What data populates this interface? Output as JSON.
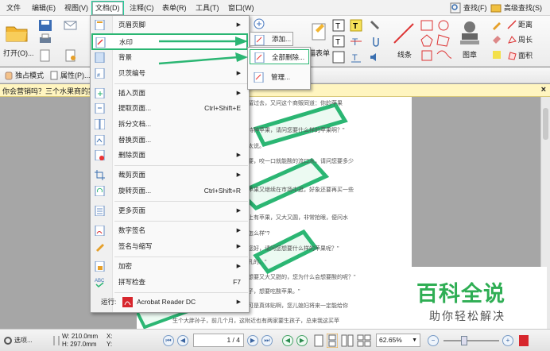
{
  "menubar": {
    "items": [
      "文件",
      "编辑(E)",
      "视图(V)",
      "文档(D)",
      "注释(C)",
      "表单(R)",
      "工具(T)",
      "窗口(W)"
    ],
    "search_label": "查找(F)",
    "advanced_search_label": "高级查找(S)"
  },
  "ribbon": {
    "open_label": "打开(O)...",
    "add_label": "添加...",
    "scan_form_label": "描表单",
    "line_label": "线条",
    "stamp_label": "图章",
    "distance_label": "距离",
    "perimeter_label": "周长",
    "area_label": "面积"
  },
  "toolbar2": {
    "exclusive_mode": "独占模式",
    "properties": "属性(P)..."
  },
  "tab": {
    "title": "你会营销吗？三个水果商的案"
  },
  "doc_lines": [
    "留过去，又问这个商贩同道：你的苹果",
    "特种苹果，请问您要什么样的苹果啊？\"",
    "太说。",
    "要，咬一口就能酸的流口水，请问您要多少",
    "苹果又继续在市场中逛，好象还要再买一些",
    "上有苹果，又大又圆，非常抢眼，便问水",
    "怎么样\"?",
    "您好，请问您想要什么样的苹果呢？\"",
    "孔的。\"",
    "想要又大又甜的，您为什么会想要酸的呢？\"",
    "子，想要吃酸苹果。\"",
    "可是真体贴啊，您儿媳妇将来一定能给你",
    "生个大胖孙子，前几个月，这附近也有两家要生孩子，总来我这买苹"
  ],
  "menu": {
    "items": [
      {
        "label": "页眉页脚",
        "shortcut": "",
        "arrow": true
      },
      {
        "label": "水印",
        "shortcut": "",
        "arrow": true,
        "highlight": true
      },
      {
        "label": "背景",
        "shortcut": "",
        "arrow": true
      },
      {
        "label": "贝茨编号",
        "shortcut": "",
        "arrow": true
      },
      {
        "label": "插入页面",
        "shortcut": "",
        "arrow": true
      },
      {
        "label": "提取页面...",
        "shortcut": "Ctrl+Shift+E",
        "arrow": false
      },
      {
        "label": "拆分文档...",
        "shortcut": "",
        "arrow": false
      },
      {
        "label": "替换页面...",
        "shortcut": "",
        "arrow": false
      },
      {
        "label": "删除页面",
        "shortcut": "",
        "arrow": true
      },
      {
        "label": "裁剪页面",
        "shortcut": "",
        "arrow": true
      },
      {
        "label": "旋转页面...",
        "shortcut": "Ctrl+Shift+R",
        "arrow": false
      },
      {
        "label": "更多页面",
        "shortcut": "",
        "arrow": true
      },
      {
        "label": "数字签名",
        "shortcut": "",
        "arrow": true
      },
      {
        "label": "签名与缩写",
        "shortcut": "",
        "arrow": true
      },
      {
        "label": "加密",
        "shortcut": "",
        "arrow": true
      },
      {
        "label": "拼写检查",
        "shortcut": "F7",
        "arrow": false
      },
      {
        "label": "运行:",
        "shortcut": "",
        "arrow": true
      }
    ],
    "run_target": "Acrobat Reader DC"
  },
  "submenu": {
    "add": "添加...",
    "remove_all": "全部删除...",
    "manage": "管理..."
  },
  "status": {
    "options": "选项...",
    "width": "W: 210.0mm",
    "height": "H: 297.0mm",
    "x": "X:",
    "y": "Y:",
    "page": "1 / 4",
    "zoom": "62.65%"
  },
  "watermark": {
    "title": "百科全说",
    "subtitle": "助你轻松解决"
  },
  "colors": {
    "accent_green": "#2bb673",
    "watermark_green": "#2fae54"
  }
}
